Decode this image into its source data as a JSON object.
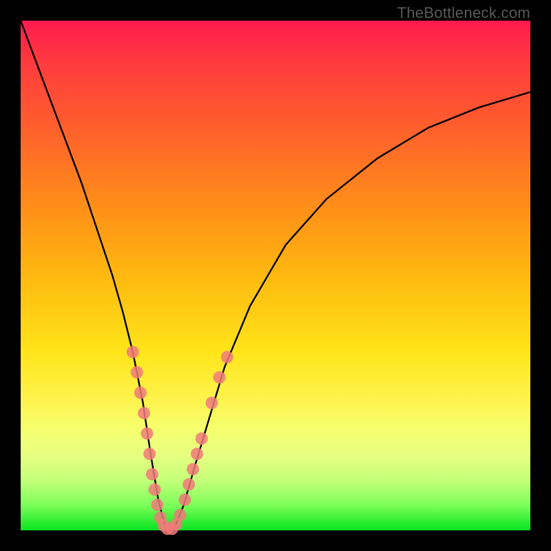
{
  "watermark": "TheBottleneck.com",
  "chart_data": {
    "type": "line",
    "title": "",
    "xlabel": "",
    "ylabel": "",
    "xlim": [
      0,
      100
    ],
    "ylim": [
      0,
      100
    ],
    "series": [
      {
        "name": "bottleneck-curve",
        "x": [
          0,
          3,
          6,
          9,
          12,
          15,
          18,
          20,
          22,
          24,
          25.5,
          27,
          28.5,
          30,
          32,
          34,
          37,
          40,
          45,
          52,
          60,
          70,
          80,
          90,
          100
        ],
        "values": [
          100,
          92,
          84,
          76,
          68,
          59,
          50,
          43,
          35,
          25,
          15,
          6,
          0,
          0,
          5,
          12,
          22,
          32,
          44,
          56,
          65,
          73,
          79,
          83,
          86
        ]
      }
    ],
    "scatter_points": {
      "name": "highlighted-points",
      "color": "#f07a7a",
      "points": [
        {
          "x": 22.0,
          "y": 35
        },
        {
          "x": 22.8,
          "y": 31
        },
        {
          "x": 23.5,
          "y": 27
        },
        {
          "x": 24.2,
          "y": 23
        },
        {
          "x": 24.8,
          "y": 19
        },
        {
          "x": 25.3,
          "y": 15
        },
        {
          "x": 25.8,
          "y": 11
        },
        {
          "x": 26.3,
          "y": 8
        },
        {
          "x": 26.8,
          "y": 5
        },
        {
          "x": 27.4,
          "y": 2.5
        },
        {
          "x": 28.0,
          "y": 1
        },
        {
          "x": 28.8,
          "y": 0.3
        },
        {
          "x": 29.7,
          "y": 0.3
        },
        {
          "x": 30.5,
          "y": 1.2
        },
        {
          "x": 31.3,
          "y": 3
        },
        {
          "x": 32.2,
          "y": 6
        },
        {
          "x": 33.0,
          "y": 9
        },
        {
          "x": 33.8,
          "y": 12
        },
        {
          "x": 34.6,
          "y": 15
        },
        {
          "x": 35.5,
          "y": 18
        },
        {
          "x": 37.5,
          "y": 25
        },
        {
          "x": 39.0,
          "y": 30
        },
        {
          "x": 40.5,
          "y": 34
        }
      ]
    }
  }
}
